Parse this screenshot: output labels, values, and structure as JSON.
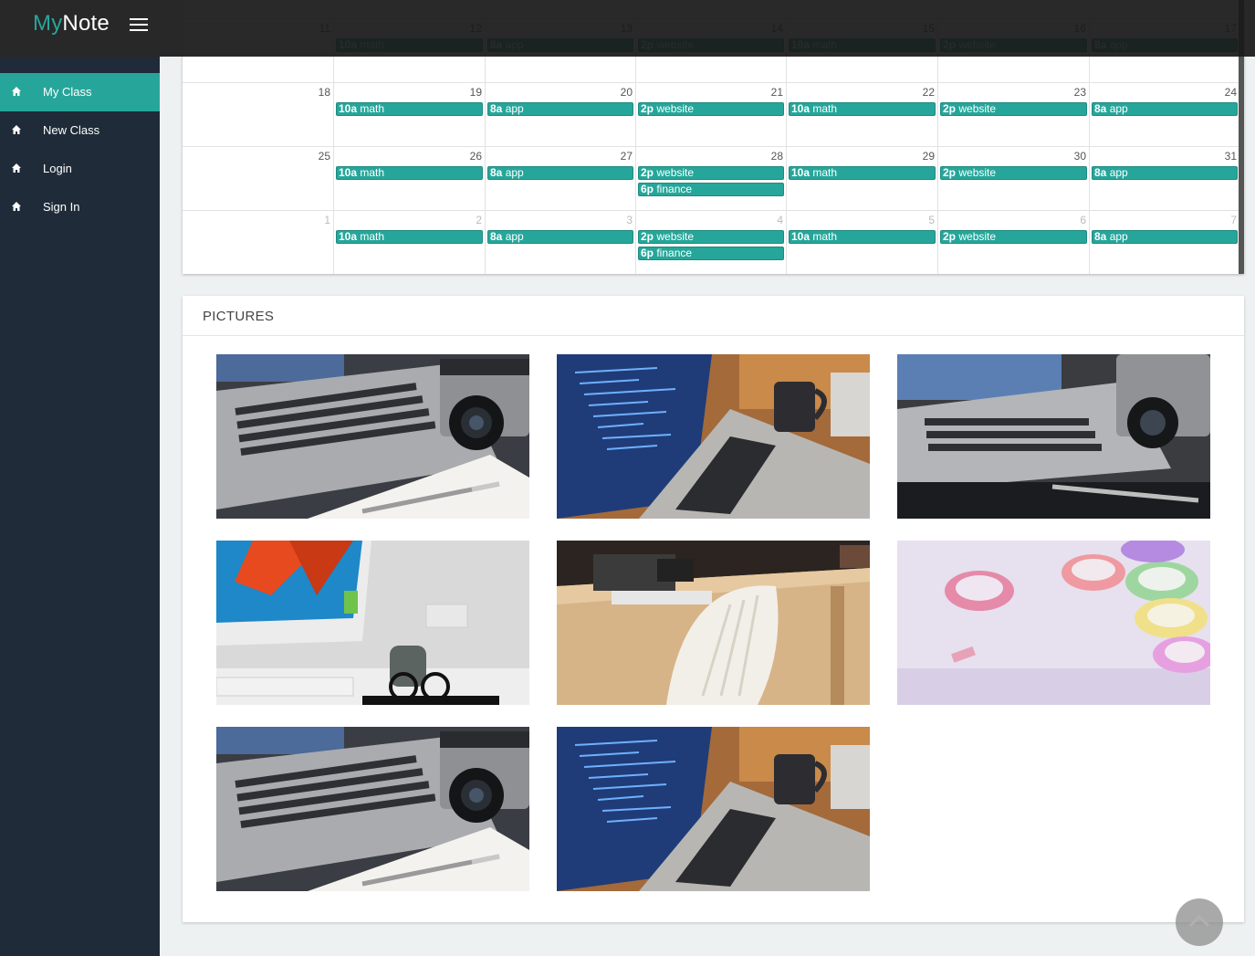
{
  "app": {
    "brand_part1": "My",
    "brand_part2": "Note",
    "menu_icon": "hamburger-icon"
  },
  "sidebar": {
    "items": [
      {
        "label": "My Class",
        "icon": "home-icon",
        "active": true
      },
      {
        "label": "New Class",
        "icon": "home-icon",
        "active": false
      },
      {
        "label": "Login",
        "icon": "home-icon",
        "active": false
      },
      {
        "label": "Sign In",
        "icon": "home-icon",
        "active": false
      }
    ]
  },
  "calendar": {
    "weeks": [
      {
        "days": [
          {
            "n": "11",
            "ev": []
          },
          {
            "n": "12",
            "ev": [
              [
                "10a",
                "math"
              ]
            ]
          },
          {
            "n": "13",
            "ev": [
              [
                "8a",
                "app"
              ]
            ]
          },
          {
            "n": "14",
            "ev": [
              [
                "2p",
                "website"
              ]
            ]
          },
          {
            "n": "15",
            "ev": [
              [
                "10a",
                "math"
              ]
            ]
          },
          {
            "n": "16",
            "ev": [
              [
                "2p",
                "website"
              ]
            ]
          },
          {
            "n": "17",
            "ev": [
              [
                "8a",
                "app"
              ]
            ]
          }
        ]
      },
      {
        "days": [
          {
            "n": "18",
            "ev": []
          },
          {
            "n": "19",
            "ev": [
              [
                "10a",
                "math"
              ]
            ]
          },
          {
            "n": "20",
            "ev": [
              [
                "8a",
                "app"
              ]
            ]
          },
          {
            "n": "21",
            "ev": [
              [
                "2p",
                "website"
              ]
            ]
          },
          {
            "n": "22",
            "ev": [
              [
                "10a",
                "math"
              ]
            ]
          },
          {
            "n": "23",
            "ev": [
              [
                "2p",
                "website"
              ]
            ]
          },
          {
            "n": "24",
            "ev": [
              [
                "8a",
                "app"
              ]
            ]
          }
        ]
      },
      {
        "days": [
          {
            "n": "25",
            "ev": []
          },
          {
            "n": "26",
            "ev": [
              [
                "10a",
                "math"
              ]
            ]
          },
          {
            "n": "27",
            "ev": [
              [
                "8a",
                "app"
              ]
            ]
          },
          {
            "n": "28",
            "ev": [
              [
                "2p",
                "website"
              ],
              [
                "6p",
                "finance"
              ]
            ]
          },
          {
            "n": "29",
            "ev": [
              [
                "10a",
                "math"
              ]
            ]
          },
          {
            "n": "30",
            "ev": [
              [
                "2p",
                "website"
              ]
            ]
          },
          {
            "n": "31",
            "ev": [
              [
                "8a",
                "app"
              ]
            ]
          }
        ]
      },
      {
        "days": [
          {
            "n": "1",
            "other": true,
            "ev": []
          },
          {
            "n": "2",
            "other": true,
            "ev": [
              [
                "10a",
                "math"
              ]
            ]
          },
          {
            "n": "3",
            "other": true,
            "ev": [
              [
                "8a",
                "app"
              ]
            ]
          },
          {
            "n": "4",
            "other": true,
            "ev": [
              [
                "2p",
                "website"
              ],
              [
                "6p",
                "finance"
              ]
            ]
          },
          {
            "n": "5",
            "other": true,
            "ev": [
              [
                "10a",
                "math"
              ]
            ]
          },
          {
            "n": "6",
            "other": true,
            "ev": [
              [
                "2p",
                "website"
              ]
            ]
          },
          {
            "n": "7",
            "other": true,
            "ev": [
              [
                "8a",
                "app"
              ]
            ]
          }
        ]
      }
    ]
  },
  "pictures": {
    "title": "PICTURES",
    "items": [
      {
        "scene": "laptop-camera-notebook"
      },
      {
        "scene": "laptop-code-mug"
      },
      {
        "scene": "laptop-camera-pen"
      },
      {
        "scene": "imac-desk-glasses"
      },
      {
        "scene": "wooden-desk-chair"
      },
      {
        "scene": "washi-tape-rolls"
      },
      {
        "scene": "laptop-camera-notebook"
      },
      {
        "scene": "laptop-code-mug"
      }
    ]
  },
  "back_to_top": {
    "icon": "chevron-up-icon"
  },
  "colors": {
    "accent": "#26a69a",
    "sidebar": "#1f2b38",
    "topbar": "#191919"
  }
}
